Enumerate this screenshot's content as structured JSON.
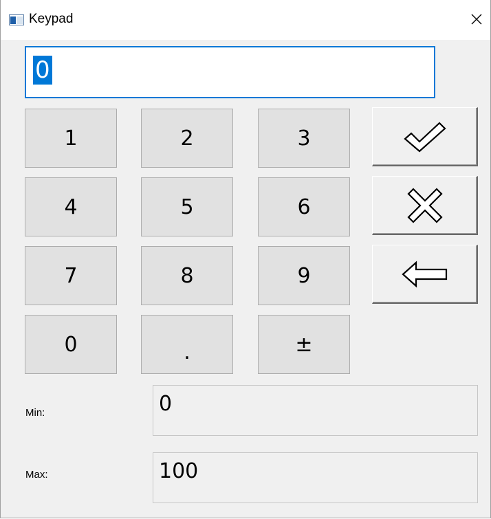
{
  "window": {
    "title": "Keypad",
    "close_glyph": "✕"
  },
  "display": {
    "value": "0"
  },
  "keys": [
    "1",
    "2",
    "3",
    "4",
    "5",
    "6",
    "7",
    "8",
    "9",
    "0",
    ".",
    "±"
  ],
  "actions": {
    "confirm_icon": "check-icon",
    "cancel_icon": "x-icon",
    "backspace_icon": "left-arrow-icon"
  },
  "limits": {
    "min_label": "Min:",
    "min_value": "0",
    "max_label": "Max:",
    "max_value": "100"
  }
}
